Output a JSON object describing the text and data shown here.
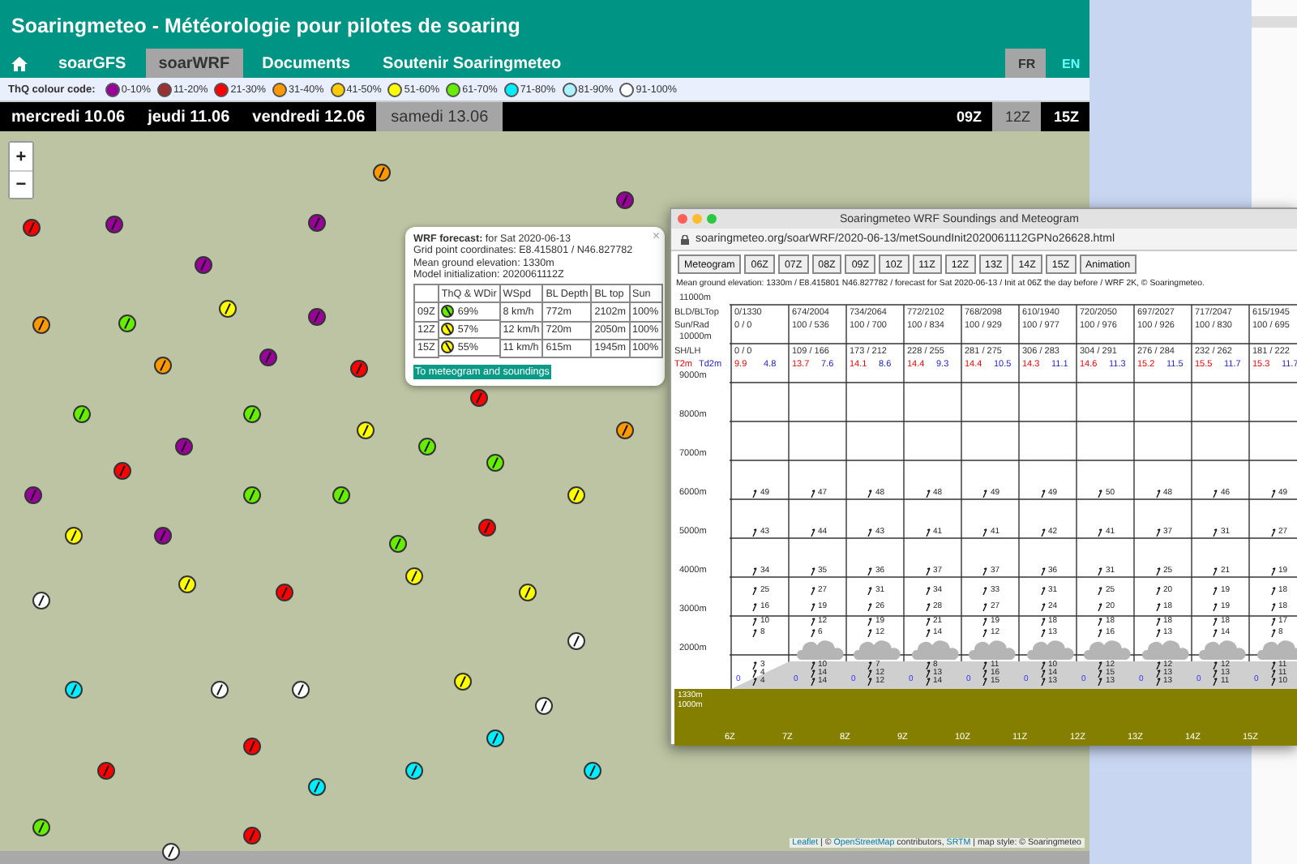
{
  "header": {
    "title": "Soaringmeteo - Météorologie pour pilotes de soaring"
  },
  "nav": {
    "tabs": [
      {
        "label": "soarGFS",
        "selected": false
      },
      {
        "label": "soarWRF",
        "selected": true
      },
      {
        "label": "Documents",
        "selected": false
      },
      {
        "label": "Soutenir Soaringmeteo",
        "selected": false
      }
    ],
    "languages": [
      {
        "label": "FR",
        "selected": true
      },
      {
        "label": "EN",
        "selected": false
      }
    ]
  },
  "colour_code": {
    "label": "ThQ colour code:",
    "items": [
      {
        "label": "0-10%",
        "color": "#9a009a"
      },
      {
        "label": "11-20%",
        "color": "#993333"
      },
      {
        "label": "21-30%",
        "color": "#ff0000"
      },
      {
        "label": "31-40%",
        "color": "#ff9900"
      },
      {
        "label": "41-50%",
        "color": "#ffcc00"
      },
      {
        "label": "51-60%",
        "color": "#ffff00"
      },
      {
        "label": "61-70%",
        "color": "#66ee00"
      },
      {
        "label": "71-80%",
        "color": "#00eeff"
      },
      {
        "label": "81-90%",
        "color": "#aaf2ff"
      },
      {
        "label": "91-100%",
        "color": "#ffffff"
      }
    ]
  },
  "days": [
    {
      "label": "mercredi 10.06",
      "selected": false
    },
    {
      "label": "jeudi 11.06",
      "selected": false
    },
    {
      "label": "vendredi 12.06",
      "selected": false
    },
    {
      "label": "samedi 13.06",
      "selected": true
    }
  ],
  "hours": [
    {
      "label": "09Z",
      "selected": false
    },
    {
      "label": "12Z",
      "selected": true
    },
    {
      "label": "15Z",
      "selected": false
    }
  ],
  "map": {
    "zoom_in": "+",
    "zoom_out": "−",
    "markers": [
      {
        "color": "#ff0000"
      },
      {
        "color": "#9a009a"
      },
      {
        "color": "#9a009a"
      },
      {
        "color": "#9a009a"
      },
      {
        "color": "#9a009a"
      },
      {
        "color": "#66ee00"
      },
      {
        "color": "#ffff00"
      },
      {
        "color": "#ff9900"
      },
      {
        "color": "#ff9900"
      },
      {
        "color": "#9a009a"
      },
      {
        "color": "#ff0000"
      },
      {
        "color": "#ff0000"
      },
      {
        "color": "#66ee00"
      },
      {
        "color": "#9a009a"
      },
      {
        "color": "#ff0000"
      },
      {
        "color": "#9a009a"
      },
      {
        "color": "#66ee00"
      },
      {
        "color": "#ffff00"
      },
      {
        "color": "#66ee00"
      },
      {
        "color": "#66ee00"
      },
      {
        "color": "#ffff00"
      },
      {
        "color": "#9a009a"
      },
      {
        "color": "#66ee00"
      },
      {
        "color": "#66ee00"
      },
      {
        "color": "#66ee00"
      },
      {
        "color": "#ff0000"
      },
      {
        "color": "#ffff00"
      },
      {
        "color": "#ff9900"
      },
      {
        "color": "#ffffff"
      },
      {
        "color": "#ffff00"
      },
      {
        "color": "#ff0000"
      },
      {
        "color": "#ffff00"
      },
      {
        "color": "#ffff00"
      },
      {
        "color": "#ffffff"
      },
      {
        "color": "#00eeff"
      },
      {
        "color": "#ffffff"
      },
      {
        "color": "#ffffff"
      },
      {
        "color": "#ffff00"
      },
      {
        "color": "#ff0000"
      },
      {
        "color": "#ff0000"
      },
      {
        "color": "#00eeff"
      },
      {
        "color": "#ffffff"
      },
      {
        "color": "#66ee00"
      },
      {
        "color": "#ff0000"
      },
      {
        "color": "#00eeff"
      },
      {
        "color": "#00eeff"
      },
      {
        "color": "#00eeff"
      },
      {
        "color": "#ffffff"
      },
      {
        "color": "#9a009a"
      },
      {
        "color": "#ff9900"
      }
    ],
    "attribution": [
      {
        "text": "Leaflet",
        "kind": "link"
      },
      {
        "text": " | © ",
        "kind": "text"
      },
      {
        "text": "OpenStreetMap",
        "kind": "link"
      },
      {
        "text": " contributors, ",
        "kind": "text"
      },
      {
        "text": "SRTM",
        "kind": "link"
      },
      {
        "text": " | map style: © Soaringmeteo",
        "kind": "text"
      }
    ]
  },
  "popup": {
    "close": "×",
    "title": "**WRF forecast:** for Sat 2020-06-13",
    "lines": [
      "Grid point coordinates: E8.415801 / N46.827782",
      "Mean ground elevation: 1330m",
      "Model initialization: 2020061112Z"
    ],
    "columns": [
      "ThQ & WDir",
      "WSpd",
      "BL Depth",
      "BL top",
      "Sun"
    ],
    "rows": [
      {
        "time": "09Z",
        "color": "#66ee00",
        "thq": "69%",
        "wspd": "8 km/h",
        "bl_depth": "772m",
        "bl_top": "2102m",
        "sun": "100%"
      },
      {
        "time": "12Z",
        "color": "#ffff00",
        "thq": "57%",
        "wspd": "12 km/h",
        "bl_depth": "720m",
        "bl_top": "2050m",
        "sun": "100%"
      },
      {
        "time": "15Z",
        "color": "#ffff00",
        "thq": "55%",
        "wspd": "11 km/h",
        "bl_depth": "615m",
        "bl_top": "1945m",
        "sun": "100%"
      }
    ],
    "link": "To meteogram and soundings"
  },
  "sounding_window": {
    "title": "Soaringmeteo WRF Soundings and Meteogram",
    "url": "soaringmeteo.org/soarWRF/2020-06-13/metSoundInit2020061112GPNo26628.html",
    "buttons": [
      "Meteogram",
      "06Z",
      "07Z",
      "08Z",
      "09Z",
      "10Z",
      "11Z",
      "12Z",
      "13Z",
      "14Z",
      "15Z",
      "Animation"
    ],
    "info": "Mean ground elevation: 1330m / E8.415801 N46.827782 / forecast for Sat 2020-06-13 / Init at 06Z the day before / WRF 2K, © Soaringmeteo.",
    "altitudes": [
      "11000m",
      "10000m",
      "9000m",
      "8000m",
      "7000m",
      "6000m",
      "5000m",
      "4000m",
      "3000m",
      "2000m"
    ],
    "ground_labels": [
      "1330m",
      "1000m"
    ],
    "row_labels": {
      "bld": "BLD/BLTop",
      "sun": "Sun/Rad",
      "shlh": "SH/LH",
      "t2m": "T2m",
      "td2m": "Td2m"
    },
    "columns": [
      {
        "time": "6Z",
        "bld": "0/1330",
        "sun": "0 / 0",
        "shlh": "0 / 0",
        "t2m": "9.9",
        "td2m": "4.8",
        "surface": "0",
        "cloud": false,
        "winds": [
          "49",
          "43",
          "34",
          "25",
          "16",
          "10",
          "8",
          "3",
          "4",
          "4"
        ]
      },
      {
        "time": "7Z",
        "bld": "674/2004",
        "sun": "100 / 536",
        "shlh": "109 / 166",
        "t2m": "13.7",
        "td2m": "7.6",
        "surface": "0",
        "cloud": true,
        "winds": [
          "47",
          "44",
          "35",
          "27",
          "19",
          "12",
          "6",
          "10",
          "14",
          "14"
        ]
      },
      {
        "time": "8Z",
        "bld": "734/2064",
        "sun": "100 / 700",
        "shlh": "173 / 212",
        "t2m": "14.1",
        "td2m": "8.6",
        "surface": "0",
        "cloud": true,
        "winds": [
          "48",
          "43",
          "36",
          "31",
          "26",
          "19",
          "12",
          "7",
          "12",
          "12"
        ]
      },
      {
        "time": "9Z",
        "bld": "772/2102",
        "sun": "100 / 834",
        "shlh": "228 / 255",
        "t2m": "14.4",
        "td2m": "9.3",
        "surface": "0",
        "cloud": true,
        "winds": [
          "48",
          "41",
          "37",
          "34",
          "28",
          "21",
          "14",
          "8",
          "13",
          "14"
        ]
      },
      {
        "time": "10Z",
        "bld": "768/2098",
        "sun": "100 / 929",
        "shlh": "281 / 275",
        "t2m": "14.4",
        "td2m": "10.5",
        "surface": "0",
        "cloud": true,
        "winds": [
          "49",
          "41",
          "37",
          "33",
          "27",
          "19",
          "12",
          "11",
          "16",
          "15"
        ]
      },
      {
        "time": "11Z",
        "bld": "610/1940",
        "sun": "100 / 977",
        "shlh": "306 / 283",
        "t2m": "14.3",
        "td2m": "11.1",
        "surface": "0",
        "cloud": true,
        "winds": [
          "49",
          "42",
          "36",
          "31",
          "24",
          "18",
          "13",
          "10",
          "14",
          "13"
        ]
      },
      {
        "time": "12Z",
        "bld": "720/2050",
        "sun": "100 / 976",
        "shlh": "304 / 291",
        "t2m": "14.6",
        "td2m": "11.3",
        "surface": "0",
        "cloud": true,
        "winds": [
          "50",
          "41",
          "31",
          "25",
          "20",
          "18",
          "16",
          "12",
          "15",
          "13"
        ]
      },
      {
        "time": "13Z",
        "bld": "697/2027",
        "sun": "100 / 926",
        "shlh": "276 / 284",
        "t2m": "15.2",
        "td2m": "11.5",
        "surface": "0",
        "cloud": true,
        "winds": [
          "48",
          "37",
          "25",
          "20",
          "18",
          "18",
          "13",
          "12",
          "13",
          "13"
        ]
      },
      {
        "time": "14Z",
        "bld": "717/2047",
        "sun": "100 / 830",
        "shlh": "232 / 262",
        "t2m": "15.5",
        "td2m": "11.7",
        "surface": "0",
        "cloud": true,
        "winds": [
          "46",
          "31",
          "21",
          "19",
          "19",
          "18",
          "14",
          "12",
          "13",
          "11"
        ]
      },
      {
        "time": "15Z",
        "bld": "615/1945",
        "sun": "100 / 695",
        "shlh": "181 / 222",
        "t2m": "15.3",
        "td2m": "11.7",
        "surface": "0",
        "cloud": true,
        "winds": [
          "49",
          "27",
          "19",
          "18",
          "18",
          "17",
          "8",
          "11",
          "11",
          "10"
        ]
      }
    ]
  }
}
